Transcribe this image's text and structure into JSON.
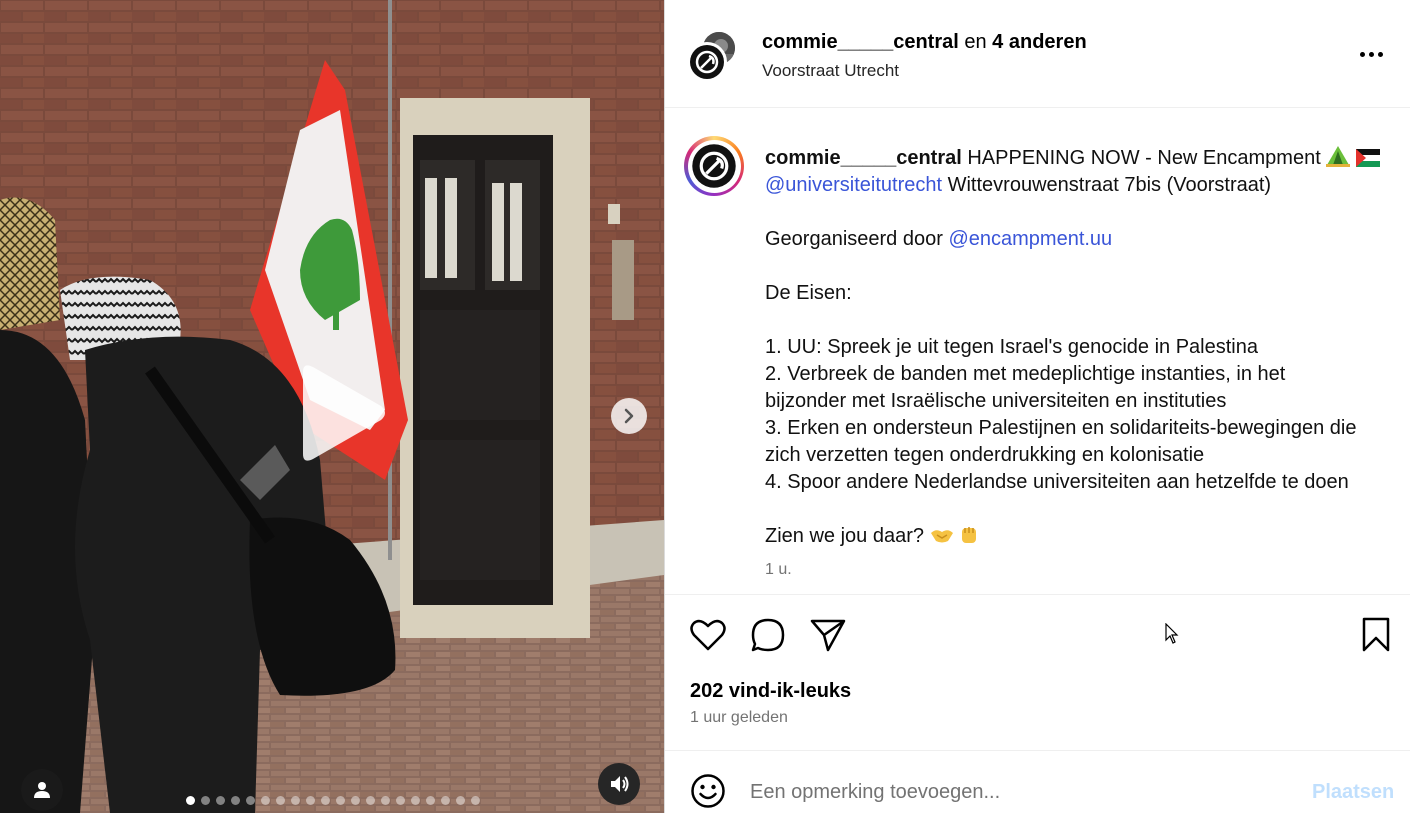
{
  "media": {
    "type": "video-carousel",
    "slide_count": 20,
    "active_slide": 1,
    "icons": {
      "play": "play-icon",
      "next": "chevron-right-icon",
      "user_tags": "user-icon",
      "audio": "speaker-icon"
    }
  },
  "header": {
    "username": "commie_____central",
    "collab_joiner": "en",
    "collab_others": "4 anderen",
    "location": "Voorstraat Utrecht",
    "more_icon": "more-horizontal-icon"
  },
  "caption": {
    "username": "commie_____central",
    "line1_text": "HAPPENING NOW - New Encampment",
    "line1_emojis": [
      "tent-emoji",
      "palestine-flag-emoji"
    ],
    "line2_mention": "@universiteitutrecht",
    "line2_text": "Wittevrouwenstraat 7bis (Voorstraat)",
    "organized_prefix": "Georganiseerd door",
    "organized_mention": "@encampment.uu",
    "demands_heading": "De Eisen:",
    "demands": [
      "1. UU: Spreek je uit tegen Israel's genocide in Palestina",
      "2. Verbreek de banden met medeplichtige instanties, in het",
      "bijzonder met Israëlische universiteiten en instituties",
      "3. Erken en ondersteun Palestijnen en solidariteits-bewegingen die",
      "zich verzetten tegen onderdrukking en kolonisatie",
      "4. Spoor andere Nederlandse universiteiten aan hetzelfde te doen"
    ],
    "closing_text": "Zien we jou daar?",
    "closing_emojis": [
      "handshake-emoji",
      "raised-fist-emoji"
    ],
    "timestamp": "1 u."
  },
  "actions": {
    "like_icon": "heart-icon",
    "comment_icon": "comment-icon",
    "share_icon": "send-icon",
    "save_icon": "bookmark-icon"
  },
  "likes": "202 vind-ik-leuks",
  "posted_ago": "1 uur geleden",
  "comment": {
    "placeholder": "Een opmerking toevoegen...",
    "post_label": "Plaatsen",
    "emoji_icon": "smiley-icon"
  },
  "colors": {
    "mention": "#3a55d8",
    "post_button_disabled": "#c0dffd",
    "secondary_text": "#737373",
    "flag_red": "#e8352a",
    "cedar_green": "#3e9a3a"
  }
}
